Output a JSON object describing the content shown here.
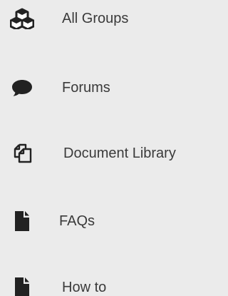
{
  "menu": {
    "items": [
      {
        "label": "All Groups",
        "icon": "cubes-icon"
      },
      {
        "label": "Forums",
        "icon": "speech-bubble-icon"
      },
      {
        "label": "Document Library",
        "icon": "copy-documents-icon"
      },
      {
        "label": "FAQs",
        "icon": "document-icon"
      },
      {
        "label": "How to",
        "icon": "document-icon"
      }
    ]
  },
  "colors": {
    "background": "#ebebeb",
    "icon": "#222222",
    "text": "#3a3a3a"
  }
}
